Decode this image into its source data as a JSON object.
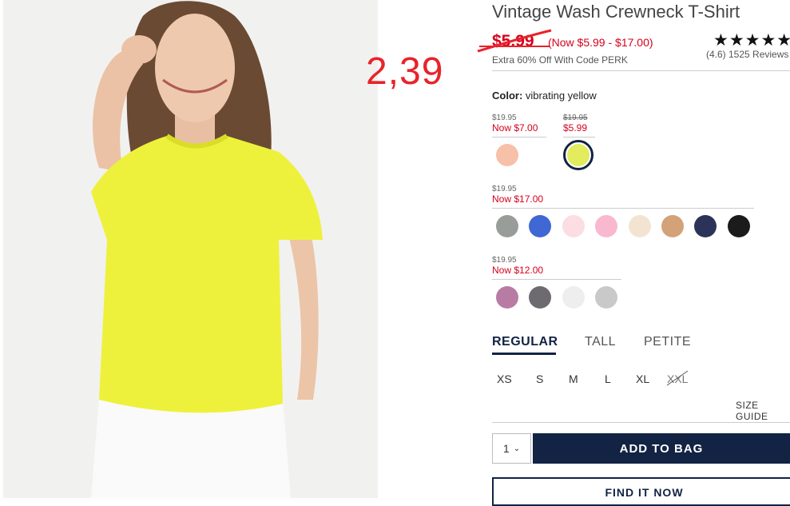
{
  "product": {
    "title": "Vintage Wash Crewneck T-Shirt",
    "price_old": "$5.99",
    "price_range": "(Now $5.99 - $17.00)",
    "promo": "Extra 60% Off With Code PERK",
    "rating_stars": "★★★★★",
    "rating_text": "(4.6) 1525 Reviews"
  },
  "annotation": {
    "text": "2,39",
    "color": "#e8232a"
  },
  "color": {
    "label": "Color:",
    "value": "vibrating yellow",
    "groups": [
      {
        "was": "$19.95",
        "now": "Now $7.00",
        "swatches": [
          "#f7c0a8"
        ]
      },
      {
        "was": "$19.95",
        "now": "$5.99",
        "swatches": [
          "#e2ec5c"
        ],
        "selected": true
      },
      {
        "was": "$19.95",
        "now": "Now $17.00",
        "swatches": [
          "#999d9a",
          "#3f68d4",
          "#fbdde3",
          "#f9b8cf",
          "#f3e4d2",
          "#d4a278",
          "#2c3359",
          "#1b1b1b"
        ]
      },
      {
        "was": "$19.95",
        "now": "Now $12.00",
        "swatches": [
          "#b87ca4",
          "#6d6b70",
          "#eeeeee",
          "#c9c9c9"
        ]
      }
    ]
  },
  "fit": {
    "tabs": [
      "REGULAR",
      "TALL",
      "PETITE"
    ],
    "selected": "REGULAR"
  },
  "sizes": [
    "XS",
    "S",
    "M",
    "L",
    "XL",
    "XXL"
  ],
  "size_guide": "SIZE GUIDE",
  "quantity": "1",
  "add_to_bag": "ADD TO BAG",
  "find_it_now": "FIND IT NOW",
  "brand_color": "#122344",
  "sale_color": "#d6001c"
}
